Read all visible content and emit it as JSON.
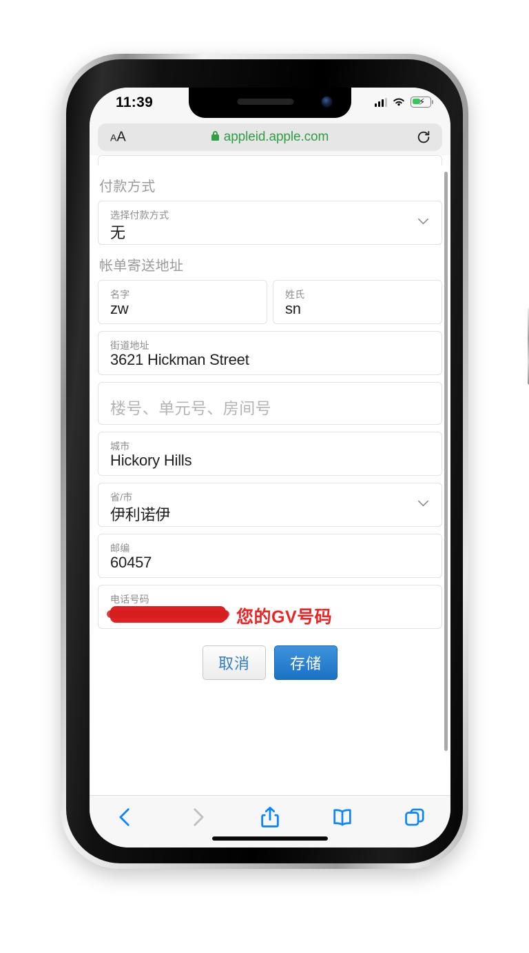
{
  "status_bar": {
    "time": "11:39",
    "signal_icon": "cellular-signal-icon",
    "wifi_icon": "wifi-icon",
    "battery_icon": "battery-charging-icon"
  },
  "browser": {
    "text_size_button": "AA",
    "lock_icon": "lock-icon",
    "url": "appleid.apple.com",
    "reload_icon": "reload-icon",
    "url_color": "#2f9e44"
  },
  "page": {
    "payment_section_title": "付款方式",
    "payment_field": {
      "label": "选择付款方式",
      "value": "无",
      "chevron_icon": "chevron-down-icon"
    },
    "billing_section_title": "帐单寄送地址",
    "first_name": {
      "label": "名字",
      "value": "zw"
    },
    "last_name": {
      "label": "姓氏",
      "value": "sn"
    },
    "street": {
      "label": "街道地址",
      "value": "3621 Hickman Street"
    },
    "apt": {
      "placeholder": "楼号、单元号、房间号",
      "value": ""
    },
    "city": {
      "label": "城市",
      "value": "Hickory Hills"
    },
    "state": {
      "label": "省/市",
      "value": "伊利诺伊",
      "chevron_icon": "chevron-down-icon"
    },
    "zip": {
      "label": "邮编",
      "value": "60457"
    },
    "phone": {
      "label": "电话号码",
      "value_redacted": true
    },
    "annotation": {
      "text": "您的GV号码",
      "color": "#ee2222"
    },
    "cancel_button": "取消",
    "save_button": "存储",
    "save_button_color": "#1a72c4"
  },
  "toolbar": {
    "back_icon": "chevron-left-icon",
    "forward_icon": "chevron-right-icon",
    "share_icon": "share-icon",
    "bookmarks_icon": "book-icon",
    "tabs_icon": "tabs-icon",
    "accent_color": "#0a84ff",
    "disabled_color": "#bfbfbf"
  }
}
